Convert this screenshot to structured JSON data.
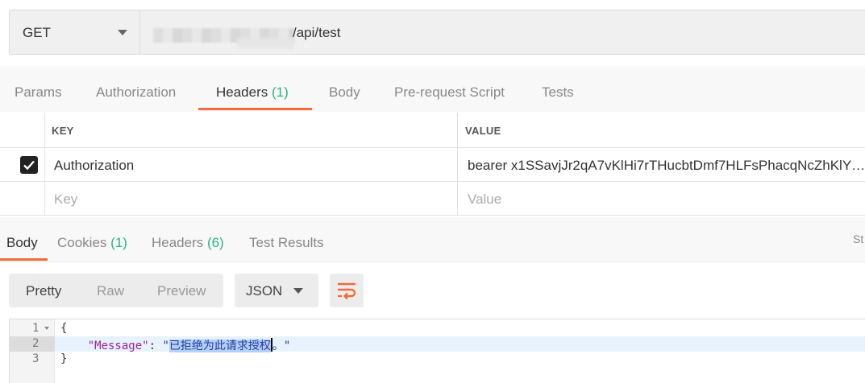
{
  "request": {
    "method": "GET",
    "url_visible": "/api/test"
  },
  "request_tabs": [
    {
      "label": "Params"
    },
    {
      "label": "Authorization"
    },
    {
      "label": "Headers",
      "count": "(1)",
      "active": true
    },
    {
      "label": "Body"
    },
    {
      "label": "Pre-request Script"
    },
    {
      "label": "Tests"
    }
  ],
  "headers_table": {
    "columns": [
      "KEY",
      "VALUE"
    ],
    "rows": [
      {
        "checked": true,
        "key": "Authorization",
        "value": "bearer x1SSavjJr2qA7vKlHi7rTHucbtDmf7HLFsPhacqNcZhKlY…"
      }
    ],
    "placeholder": {
      "key": "Key",
      "value": "Value"
    }
  },
  "response_tabs": [
    {
      "label": "Body",
      "active": true
    },
    {
      "label": "Cookies",
      "count": "(1)"
    },
    {
      "label": "Headers",
      "count": "(6)"
    },
    {
      "label": "Test Results"
    }
  ],
  "status_truncated": "St",
  "view_modes": [
    "Pretty",
    "Raw",
    "Preview"
  ],
  "active_view_mode": "Pretty",
  "format": "JSON",
  "response_body": {
    "line_numbers": [
      "1",
      "2",
      "3"
    ],
    "open_brace": "{",
    "close_brace": "}",
    "indent": "    ",
    "key": "\"Message\"",
    "colon": ": ",
    "quote_open": "\"",
    "value_selected": "已拒绝为此请求授权",
    "value_tail": "。",
    "quote_close": "\""
  },
  "colors": {
    "accent": "#f26b3a",
    "count_green": "#26b47f",
    "json_key": "#9b2393",
    "json_string": "#1e3ba8"
  }
}
